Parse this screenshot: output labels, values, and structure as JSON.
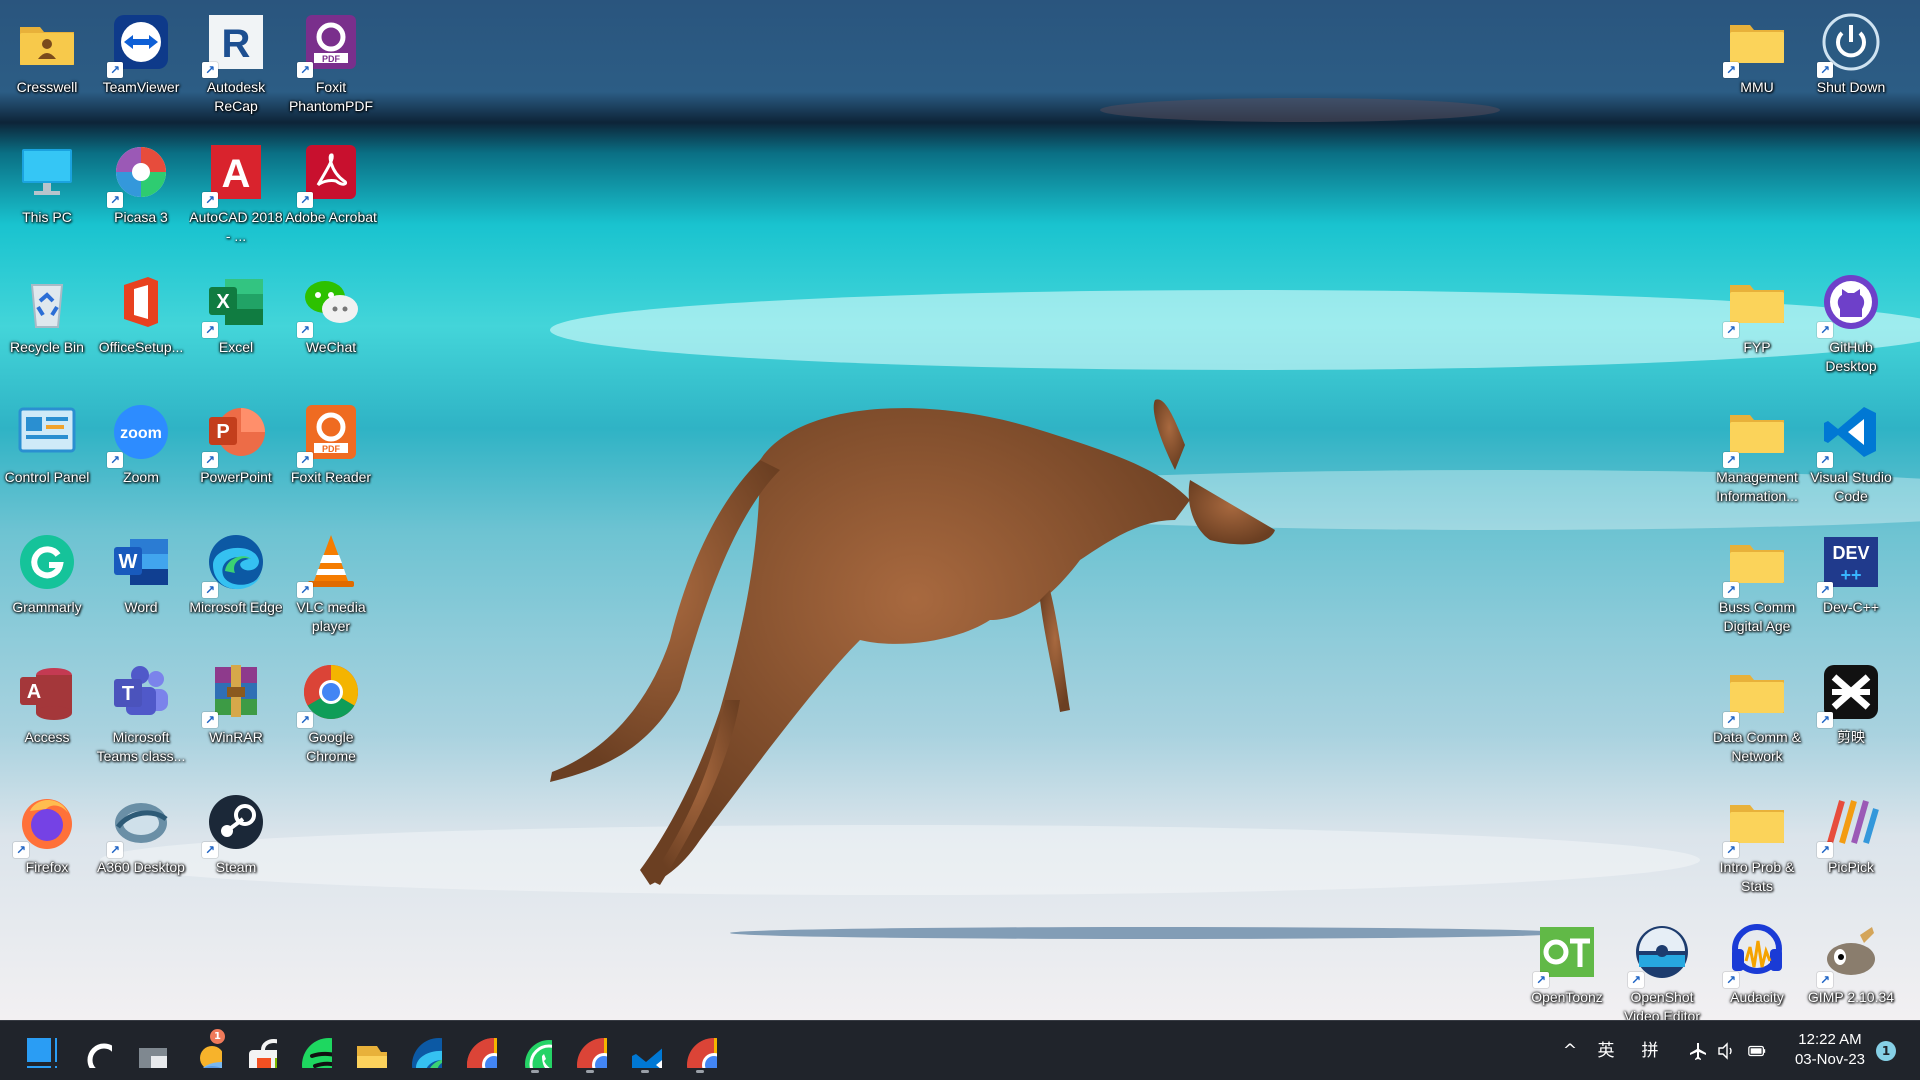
{
  "desktop": {
    "left_icons": [
      {
        "label": "Cresswell",
        "icon": "user-folder-icon",
        "shortcut": false
      },
      {
        "label": "TeamViewer",
        "icon": "teamviewer-icon",
        "shortcut": true
      },
      {
        "label": "Autodesk ReCap",
        "icon": "autodesk-recap-icon",
        "shortcut": true
      },
      {
        "label": "Foxit PhantomPDF",
        "icon": "foxit-phantompdf-icon",
        "shortcut": true
      },
      {
        "label": "This PC",
        "icon": "monitor-icon",
        "shortcut": false
      },
      {
        "label": "Picasa 3",
        "icon": "picasa-icon",
        "shortcut": true
      },
      {
        "label": "AutoCAD 2018 - ...",
        "icon": "autocad-icon",
        "shortcut": true
      },
      {
        "label": "Adobe Acrobat",
        "icon": "adobe-acrobat-icon",
        "shortcut": true
      },
      {
        "label": "Recycle Bin",
        "icon": "recycle-bin-icon",
        "shortcut": false
      },
      {
        "label": "OfficeSetup...",
        "icon": "office-icon",
        "shortcut": false
      },
      {
        "label": "Excel",
        "icon": "excel-icon",
        "shortcut": true
      },
      {
        "label": "WeChat",
        "icon": "wechat-icon",
        "shortcut": true
      },
      {
        "label": "Control Panel",
        "icon": "control-panel-icon",
        "shortcut": false
      },
      {
        "label": "Zoom",
        "icon": "zoom-icon",
        "shortcut": true
      },
      {
        "label": "PowerPoint",
        "icon": "powerpoint-icon",
        "shortcut": true
      },
      {
        "label": "Foxit Reader",
        "icon": "foxit-reader-icon",
        "shortcut": true
      },
      {
        "label": "Grammarly",
        "icon": "grammarly-icon",
        "shortcut": false
      },
      {
        "label": "Word",
        "icon": "word-icon",
        "shortcut": false
      },
      {
        "label": "Microsoft Edge",
        "icon": "edge-icon",
        "shortcut": true
      },
      {
        "label": "VLC media player",
        "icon": "vlc-icon",
        "shortcut": true
      },
      {
        "label": "Access",
        "icon": "access-icon",
        "shortcut": false
      },
      {
        "label": "Microsoft Teams class...",
        "icon": "teams-icon",
        "shortcut": false
      },
      {
        "label": "WinRAR",
        "icon": "winrar-icon",
        "shortcut": true
      },
      {
        "label": "Google Chrome",
        "icon": "chrome-icon",
        "shortcut": true
      },
      {
        "label": "Firefox",
        "icon": "firefox-icon",
        "shortcut": true
      },
      {
        "label": "A360 Desktop",
        "icon": "a360-icon",
        "shortcut": true
      },
      {
        "label": "Steam",
        "icon": "steam-icon",
        "shortcut": true
      }
    ],
    "right_icons": [
      {
        "label": "MMU",
        "icon": "folder-icon",
        "shortcut": true
      },
      {
        "label": "Shut Down",
        "icon": "power-icon",
        "shortcut": true
      },
      {
        "label": "FYP",
        "icon": "folder-icon",
        "shortcut": true
      },
      {
        "label": "GitHub Desktop",
        "icon": "github-icon",
        "shortcut": true
      },
      {
        "label": "Management Information...",
        "icon": "folder-icon",
        "shortcut": true
      },
      {
        "label": "Visual Studio Code",
        "icon": "vscode-icon",
        "shortcut": true
      },
      {
        "label": "Buss Comm Digital Age",
        "icon": "folder-icon",
        "shortcut": true
      },
      {
        "label": "Dev-C++",
        "icon": "devcpp-icon",
        "shortcut": true
      },
      {
        "label": "Data Comm & Network",
        "icon": "folder-icon",
        "shortcut": true
      },
      {
        "label": "剪映",
        "icon": "capcut-icon",
        "shortcut": true
      },
      {
        "label": "Intro Prob & Stats",
        "icon": "folder-icon",
        "shortcut": true
      },
      {
        "label": "PicPick",
        "icon": "picpick-icon",
        "shortcut": true
      },
      {
        "label": "OpenToonz",
        "icon": "opentoonz-icon",
        "shortcut": true
      },
      {
        "label": "OpenShot Video Editor",
        "icon": "openshot-icon",
        "shortcut": true
      },
      {
        "label": "Audacity",
        "icon": "audacity-icon",
        "shortcut": true
      },
      {
        "label": "GIMP 2.10.34",
        "icon": "gimp-icon",
        "shortcut": true
      }
    ]
  },
  "taskbar": {
    "pinned": [
      {
        "name": "start-button",
        "icon": "windows-logo-icon",
        "running": false
      },
      {
        "name": "search-button",
        "icon": "search-icon",
        "running": false
      },
      {
        "name": "task-view-button",
        "icon": "task-view-icon",
        "running": false
      },
      {
        "name": "widgets-button",
        "icon": "weather-icon",
        "running": false,
        "badge": "1"
      },
      {
        "name": "store-button",
        "icon": "store-icon",
        "running": false
      },
      {
        "name": "spotify-button",
        "icon": "spotify-icon",
        "running": false
      },
      {
        "name": "file-explorer-button",
        "icon": "file-explorer-icon",
        "running": false
      },
      {
        "name": "edge-button",
        "icon": "edge-icon",
        "running": false
      },
      {
        "name": "chrome-button",
        "icon": "chrome-icon",
        "running": false
      },
      {
        "name": "whatsapp-button",
        "icon": "whatsapp-icon",
        "running": true
      },
      {
        "name": "chrome-profile-button",
        "icon": "chrome-profile-icon",
        "running": true
      },
      {
        "name": "vscode-button",
        "icon": "vscode-icon",
        "running": true
      },
      {
        "name": "chrome-profile-2-button",
        "icon": "chrome-profile-icon",
        "running": true
      }
    ],
    "tray": {
      "overflow": "^",
      "ime_lang": "英",
      "ime_mode": "拼",
      "time": "12:22 AM",
      "date": "03-Nov-23",
      "notifications": "1"
    }
  }
}
